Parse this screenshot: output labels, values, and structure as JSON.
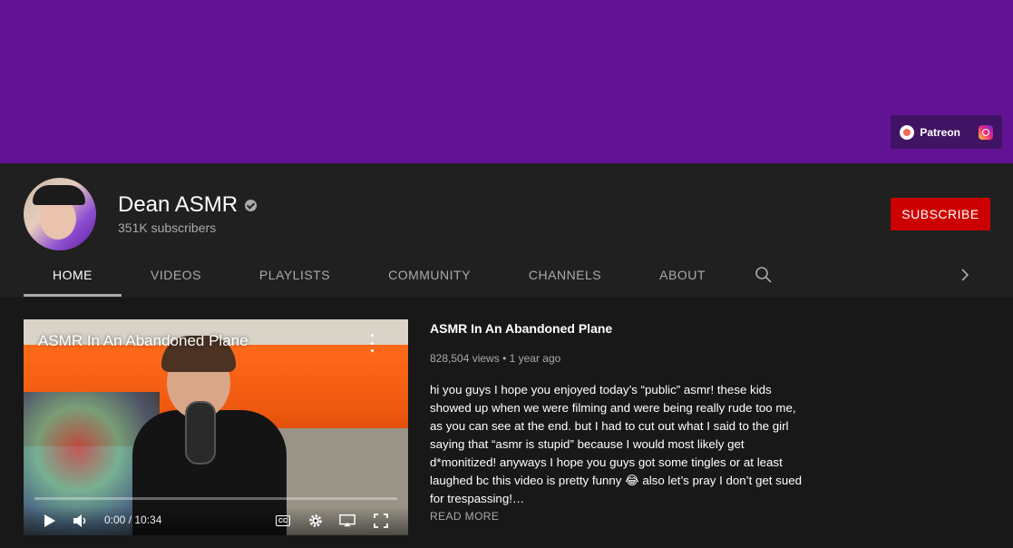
{
  "banner": {
    "links": [
      {
        "label": "Patreon",
        "icon": "patreon-icon"
      },
      {
        "label": "",
        "icon": "instagram-icon"
      }
    ]
  },
  "channel": {
    "name": "Dean ASMR",
    "subscribers": "351K subscribers",
    "subscribe_label": "SUBSCRIBE"
  },
  "tabs": [
    "HOME",
    "VIDEOS",
    "PLAYLISTS",
    "COMMUNITY",
    "CHANNELS",
    "ABOUT"
  ],
  "active_tab": "HOME",
  "featured_video": {
    "title": "ASMR In An Abandoned Plane",
    "overlay_title": "ASMR In An Abandoned Plane",
    "time_display": "0:00 / 10:34",
    "views": "828,504 views",
    "separator": "•",
    "age": "1 year ago",
    "description": "hi you guys I hope you enjoyed today’s “public” asmr! these kids showed up when we were filming and were being really rude too me, as you can see at the end. but I had to cut out what I said to the girl saying that “asmr is stupid” because I would most likely get d*monitized! anyways I hope you guys got some tingles or at least laughed bc this video is pretty funny 😂 also let’s pray I don’t get sued for trespassing!…",
    "read_more": "READ MORE"
  },
  "colors": {
    "banner": "#611394",
    "header_bg": "#202020",
    "page_bg": "#181818",
    "subscribe": "#cc0000"
  }
}
